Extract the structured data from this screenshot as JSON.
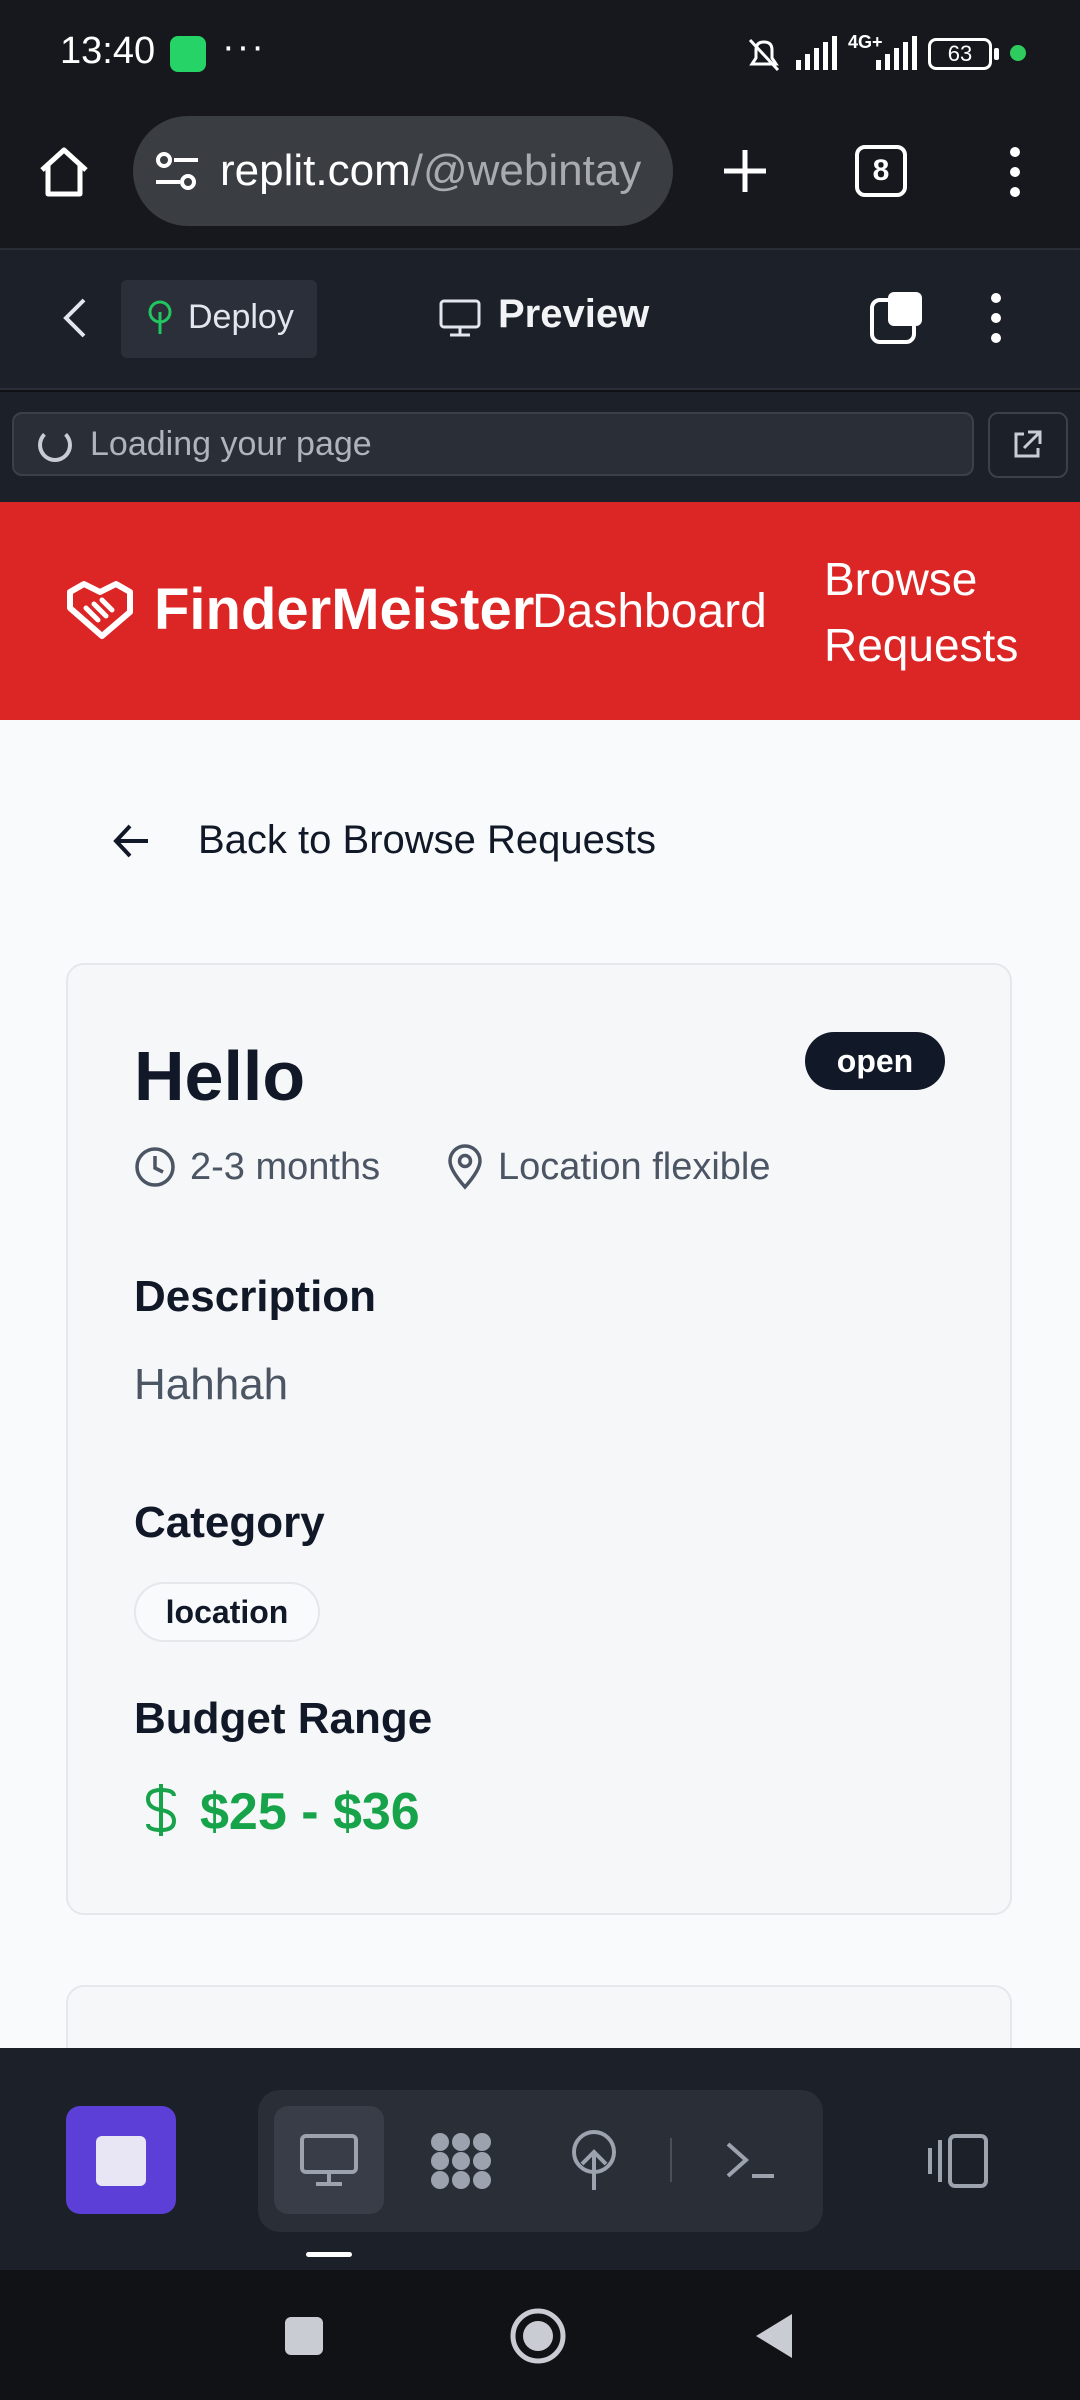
{
  "status_bar": {
    "time": "13:40",
    "more": "···",
    "network": "4G+",
    "battery": "63"
  },
  "browser": {
    "url_host": "replit.com",
    "url_path": "/@webintay",
    "tab_count": "8"
  },
  "replit_toolbar": {
    "deploy_label": "Deploy",
    "preview_label": "Preview"
  },
  "loading": {
    "text": "Loading your page"
  },
  "app_header": {
    "brand": "FinderMeister",
    "dashboard": "Dashboard",
    "browse_line1": "Browse",
    "browse_line2": "Requests"
  },
  "back_link": "Back to Browse Requests",
  "request": {
    "title": "Hello",
    "status": "open",
    "duration": "2-3 months",
    "location": "Location flexible",
    "description_heading": "Description",
    "description": "Hahhah",
    "category_heading": "Category",
    "category": "location",
    "budget_heading": "Budget Range",
    "budget": "$25 - $36"
  },
  "colors": {
    "header_red": "#dc2626",
    "budget_green": "#16a34a",
    "accent_purple": "#5b3fd6"
  }
}
